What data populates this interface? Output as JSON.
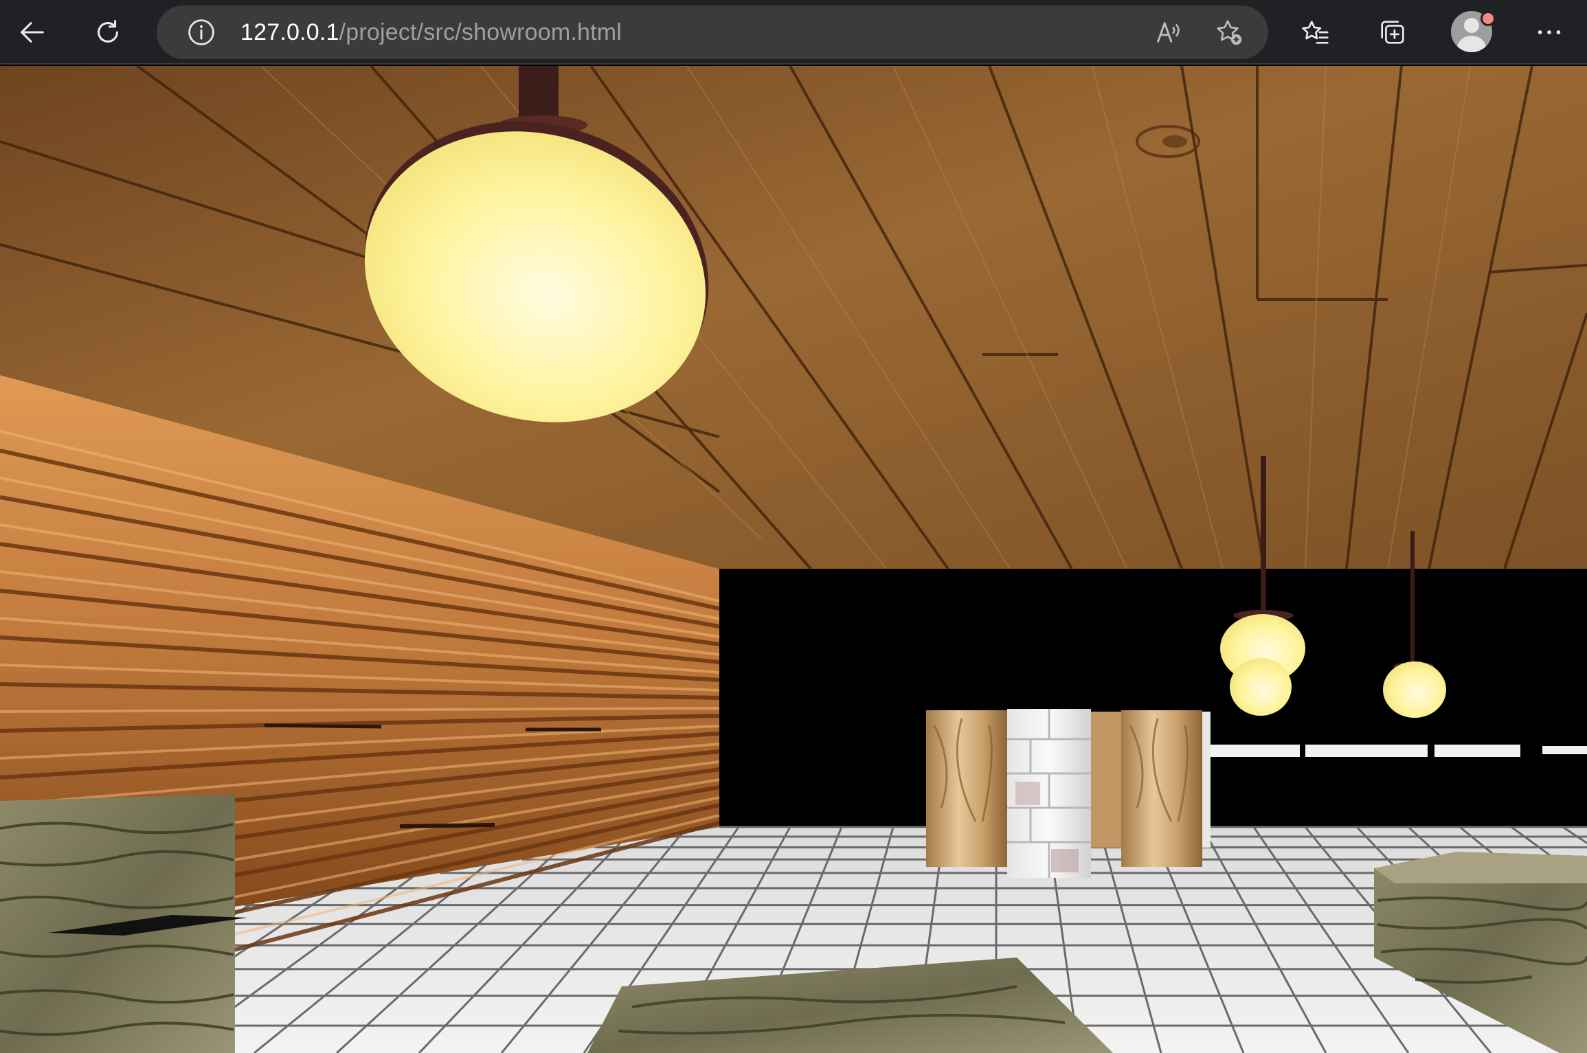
{
  "browser": {
    "url_host": "127.0.0.1",
    "url_path": "/project/src/showroom.html",
    "icons": {
      "back": "back-arrow-icon",
      "refresh": "refresh-icon",
      "site_info": "info-icon",
      "read_aloud": "read-aloud-icon",
      "add_favorite": "add-favorite-icon",
      "favorites": "favorites-icon",
      "collections": "collections-icon",
      "profile": "profile-avatar-icon",
      "more": "more-dots-icon"
    },
    "colors": {
      "toolbar_bg": "#202124",
      "addressbar_bg": "#3b3b3b",
      "url_host": "#ffffff",
      "url_path": "#9aa0a6",
      "notification_dot": "#f28b82"
    }
  },
  "scene": {
    "name": "showroom",
    "colors": {
      "ceiling_wood": "#8a5a2c",
      "log_wall": "#c07a3e",
      "floor_tile": "#e9e9e9",
      "grout": "#6a6a6a",
      "lamp_glow": "#fff7a8",
      "lamp_rod": "#3a1c18",
      "bark": "#7d7a5c",
      "background": "#000000"
    }
  }
}
